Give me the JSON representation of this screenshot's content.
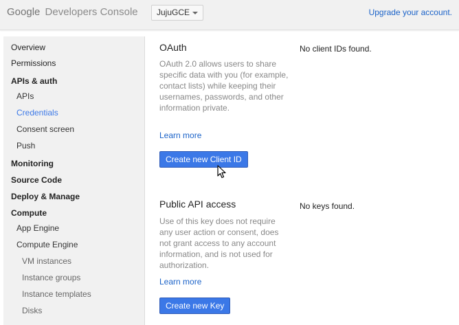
{
  "header": {
    "logo_google": "Google",
    "logo_product": "Developers Console",
    "project": "JujuGCE",
    "upgrade_link": "Upgrade your account."
  },
  "sidebar": {
    "items": [
      {
        "label": "Overview",
        "level": 0,
        "bold": false
      },
      {
        "label": "Permissions",
        "level": 0,
        "bold": false
      },
      {
        "label": "APIs & auth",
        "level": 0,
        "bold": true
      },
      {
        "label": "APIs",
        "level": 1,
        "bold": false
      },
      {
        "label": "Credentials",
        "level": 1,
        "bold": false,
        "active": true
      },
      {
        "label": "Consent screen",
        "level": 1,
        "bold": false
      },
      {
        "label": "Push",
        "level": 1,
        "bold": false
      },
      {
        "label": "Monitoring",
        "level": 0,
        "bold": true
      },
      {
        "label": "Source Code",
        "level": 0,
        "bold": true
      },
      {
        "label": "Deploy & Manage",
        "level": 0,
        "bold": true
      },
      {
        "label": "Compute",
        "level": 0,
        "bold": true
      },
      {
        "label": "App Engine",
        "level": 1,
        "bold": false
      },
      {
        "label": "Compute Engine",
        "level": 1,
        "bold": false
      },
      {
        "label": "VM instances",
        "level": 2,
        "bold": false
      },
      {
        "label": "Instance groups",
        "level": 2,
        "bold": false
      },
      {
        "label": "Instance templates",
        "level": 2,
        "bold": false
      },
      {
        "label": "Disks",
        "level": 2,
        "bold": false
      }
    ]
  },
  "oauth": {
    "title": "OAuth",
    "description": "OAuth 2.0 allows users to share specific data with you (for example, contact lists) while keeping their usernames, passwords, and other information private.",
    "learn_more": "Learn more",
    "button": "Create new Client ID",
    "empty_message": "No client IDs found."
  },
  "public_api": {
    "title": "Public API access",
    "description": "Use of this key does not require any user action or consent, does not grant access to any account information, and is not used for authorization.",
    "learn_more": "Learn more",
    "button": "Create new Key",
    "empty_message": "No keys found."
  },
  "colors": {
    "accent": "#3b78e7",
    "link": "#1a62c8",
    "sidebar_bg": "#f1f1f1"
  }
}
